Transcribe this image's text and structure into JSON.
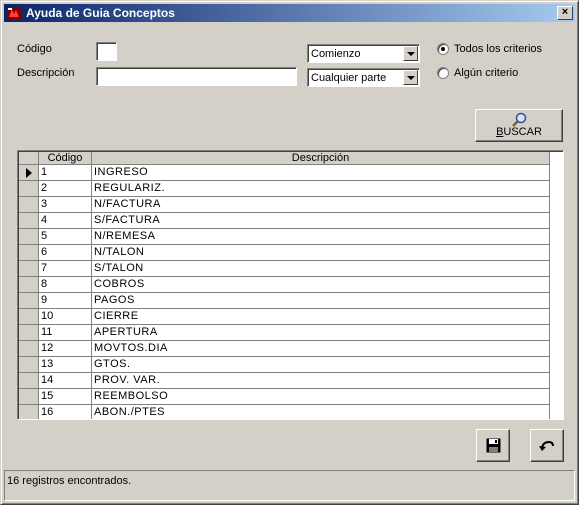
{
  "window": {
    "title": "Ayuda de Guia Conceptos",
    "close_label": "×"
  },
  "filters": {
    "codigo_label": "Código",
    "codigo_value": "",
    "descripcion_label": "Descripción",
    "descripcion_value": "",
    "codigo_match": "Comienzo",
    "descripcion_match": "Cualquier parte",
    "criteria_all_label": "Todos los criterios",
    "criteria_any_label": "Algún criterio",
    "criteria_selected": "all"
  },
  "search_button": {
    "label_prefix": "B",
    "label_rest": "USCAR",
    "icon": "magnifier-icon"
  },
  "table": {
    "columns": [
      "Código",
      "Descripción"
    ],
    "current_row": 0,
    "rows": [
      {
        "codigo": "1",
        "descripcion": "INGRESO"
      },
      {
        "codigo": "2",
        "descripcion": "REGULARIZ."
      },
      {
        "codigo": "3",
        "descripcion": "N/FACTURA"
      },
      {
        "codigo": "4",
        "descripcion": "S/FACTURA"
      },
      {
        "codigo": "5",
        "descripcion": "N/REMESA"
      },
      {
        "codigo": "6",
        "descripcion": "N/TALON"
      },
      {
        "codigo": "7",
        "descripcion": "S/TALON"
      },
      {
        "codigo": "8",
        "descripcion": "COBROS"
      },
      {
        "codigo": "9",
        "descripcion": "PAGOS"
      },
      {
        "codigo": "10",
        "descripcion": "CIERRE"
      },
      {
        "codigo": "11",
        "descripcion": "APERTURA"
      },
      {
        "codigo": "12",
        "descripcion": "MOVTOS.DIA"
      },
      {
        "codigo": "13",
        "descripcion": "GTOS."
      },
      {
        "codigo": "14",
        "descripcion": "PROV. VAR."
      },
      {
        "codigo": "15",
        "descripcion": "REEMBOLSO"
      },
      {
        "codigo": "16",
        "descripcion": "ABON./PTES"
      }
    ]
  },
  "actions": {
    "save_icon": "floppy-disk-icon",
    "undo_icon": "undo-arrow-icon"
  },
  "status": {
    "text": "16 registros encontrados."
  },
  "colors": {
    "title_start": "#0a246a",
    "title_end": "#a6caf0",
    "face": "#d4d0c8"
  }
}
